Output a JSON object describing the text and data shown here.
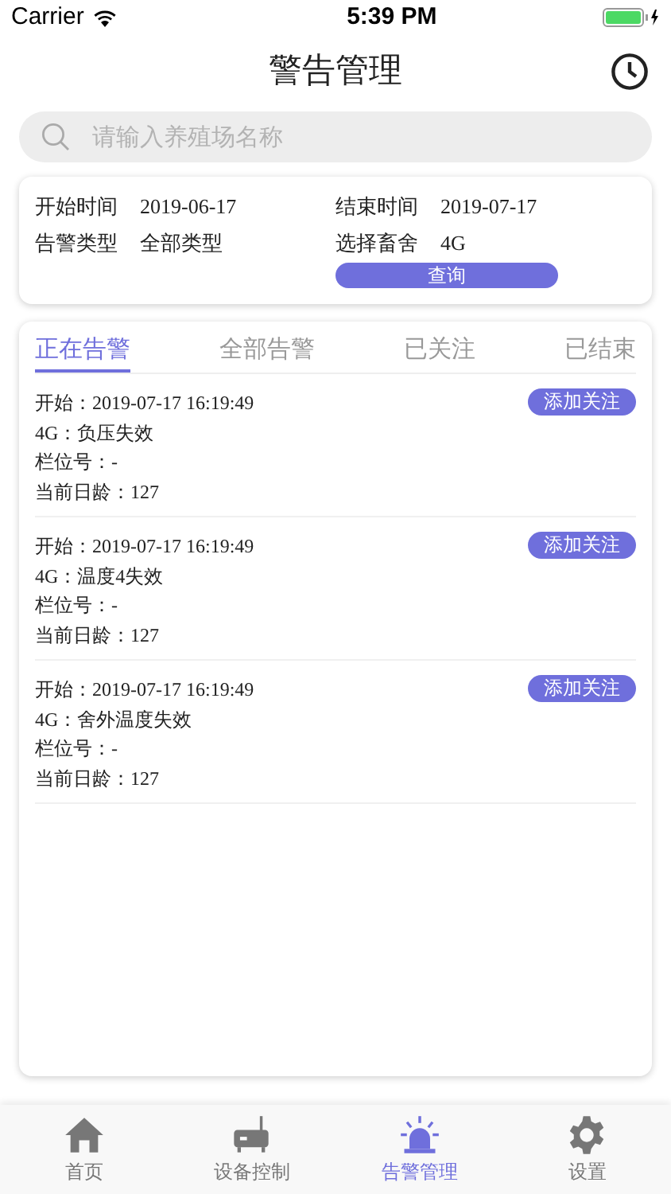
{
  "status_bar": {
    "carrier": "Carrier",
    "time": "5:39 PM"
  },
  "header": {
    "title": "警告管理"
  },
  "search": {
    "placeholder": "请输入养殖场名称"
  },
  "filters": [
    {
      "label": "开始时间",
      "value": "2019-06-17"
    },
    {
      "label": "结束时间",
      "value": "2019-07-17"
    },
    {
      "label": "告警类型",
      "value": "全部类型"
    },
    {
      "label": "选择畜舍",
      "value": "4G"
    }
  ],
  "query_button": "查询",
  "tabs": [
    {
      "label": "正在告警",
      "selected": true
    },
    {
      "label": "全部告警",
      "selected": false
    },
    {
      "label": "已关注",
      "selected": false
    },
    {
      "label": "已结束",
      "selected": false
    }
  ],
  "alerts": [
    {
      "lines": [
        "开始：2019-07-17 16:19:49",
        "4G：负压失效",
        "栏位号：-",
        "当前日龄：127"
      ],
      "button": "添加关注"
    },
    {
      "lines": [
        "开始：2019-07-17 16:19:49",
        "4G：温度4失效",
        "栏位号：-",
        "当前日龄：127"
      ],
      "button": "添加关注"
    },
    {
      "lines": [
        "开始：2019-07-17 16:19:49",
        "4G：舍外温度失效",
        "栏位号：-",
        "当前日龄：127"
      ],
      "button": "添加关注"
    }
  ],
  "tab_bar": [
    {
      "kind": "home",
      "label": "首页",
      "selected": false
    },
    {
      "kind": "device",
      "label": "设备控制",
      "selected": false
    },
    {
      "kind": "alarm",
      "label": "告警管理",
      "selected": true
    },
    {
      "kind": "settings",
      "label": "设置",
      "selected": false
    }
  ]
}
